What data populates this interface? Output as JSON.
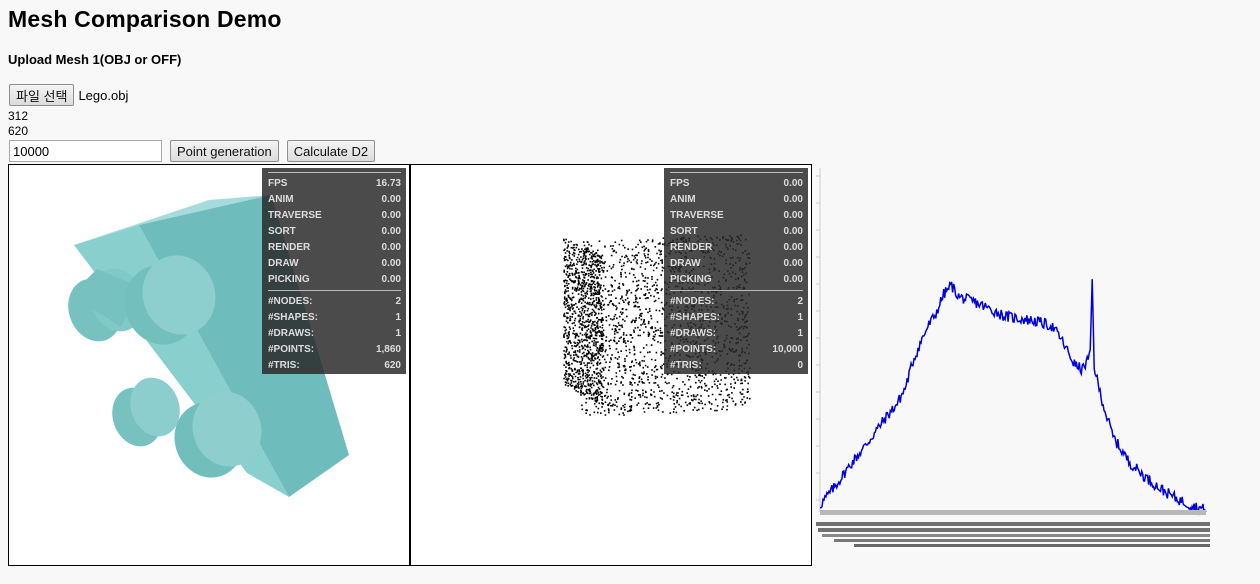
{
  "page": {
    "title": "Mesh Comparison Demo",
    "upload_label": "Upload Mesh 1(OBJ or OFF)",
    "file_button": "파일 선택",
    "file_name": "Lego.obj",
    "vertex_count": "312",
    "face_count": "620"
  },
  "controls": {
    "points_value": "10000",
    "point_generation_button": "Point generation",
    "calculate_button": "Calculate D2"
  },
  "viewport1": {
    "stats_timing": [
      {
        "label": "FPS",
        "value": "16.73"
      },
      {
        "label": "ANIM",
        "value": "0.00"
      },
      {
        "label": "TRAVERSE",
        "value": "0.00"
      },
      {
        "label": "SORT",
        "value": "0.00"
      },
      {
        "label": "RENDER",
        "value": "0.00"
      },
      {
        "label": "DRAW",
        "value": "0.00"
      },
      {
        "label": "PICKING",
        "value": "0.00"
      }
    ],
    "stats_counts": [
      {
        "label": "#NODES:",
        "value": "2"
      },
      {
        "label": "#SHAPES:",
        "value": "1"
      },
      {
        "label": "#DRAWS:",
        "value": "1"
      },
      {
        "label": "#POINTS:",
        "value": "1,860"
      },
      {
        "label": "#TRIS:",
        "value": "620"
      }
    ],
    "mesh_color": "#7fc9c8"
  },
  "viewport2": {
    "stats_timing": [
      {
        "label": "FPS",
        "value": "0.00"
      },
      {
        "label": "ANIM",
        "value": "0.00"
      },
      {
        "label": "TRAVERSE",
        "value": "0.00"
      },
      {
        "label": "SORT",
        "value": "0.00"
      },
      {
        "label": "RENDER",
        "value": "0.00"
      },
      {
        "label": "DRAW",
        "value": "0.00"
      },
      {
        "label": "PICKING",
        "value": "0.00"
      }
    ],
    "stats_counts": [
      {
        "label": "#NODES:",
        "value": "2"
      },
      {
        "label": "#SHAPES:",
        "value": "1"
      },
      {
        "label": "#DRAWS:",
        "value": "1"
      },
      {
        "label": "#POINTS:",
        "value": "10,000"
      },
      {
        "label": "#TRIS:",
        "value": "0"
      }
    ],
    "point_color": "#000000"
  },
  "chart_data": {
    "type": "line",
    "title": "",
    "xlabel": "",
    "ylabel": "",
    "line_color": "#0000dd",
    "x": [
      0,
      0.04,
      0.08,
      0.12,
      0.16,
      0.2,
      0.22,
      0.24,
      0.26,
      0.28,
      0.3,
      0.32,
      0.34,
      0.36,
      0.4,
      0.44,
      0.48,
      0.52,
      0.56,
      0.6,
      0.62,
      0.64,
      0.66,
      0.68,
      0.7,
      0.705,
      0.71,
      0.72,
      0.74,
      0.76,
      0.8,
      0.84,
      0.88,
      0.92,
      0.96,
      1.0
    ],
    "values": [
      0.02,
      0.1,
      0.19,
      0.27,
      0.36,
      0.44,
      0.5,
      0.61,
      0.69,
      0.76,
      0.81,
      0.89,
      0.93,
      0.88,
      0.86,
      0.83,
      0.8,
      0.79,
      0.78,
      0.76,
      0.72,
      0.66,
      0.6,
      0.58,
      0.64,
      0.96,
      0.6,
      0.52,
      0.4,
      0.3,
      0.2,
      0.14,
      0.09,
      0.05,
      0.02,
      0.0
    ],
    "ylim": [
      0,
      1
    ]
  }
}
